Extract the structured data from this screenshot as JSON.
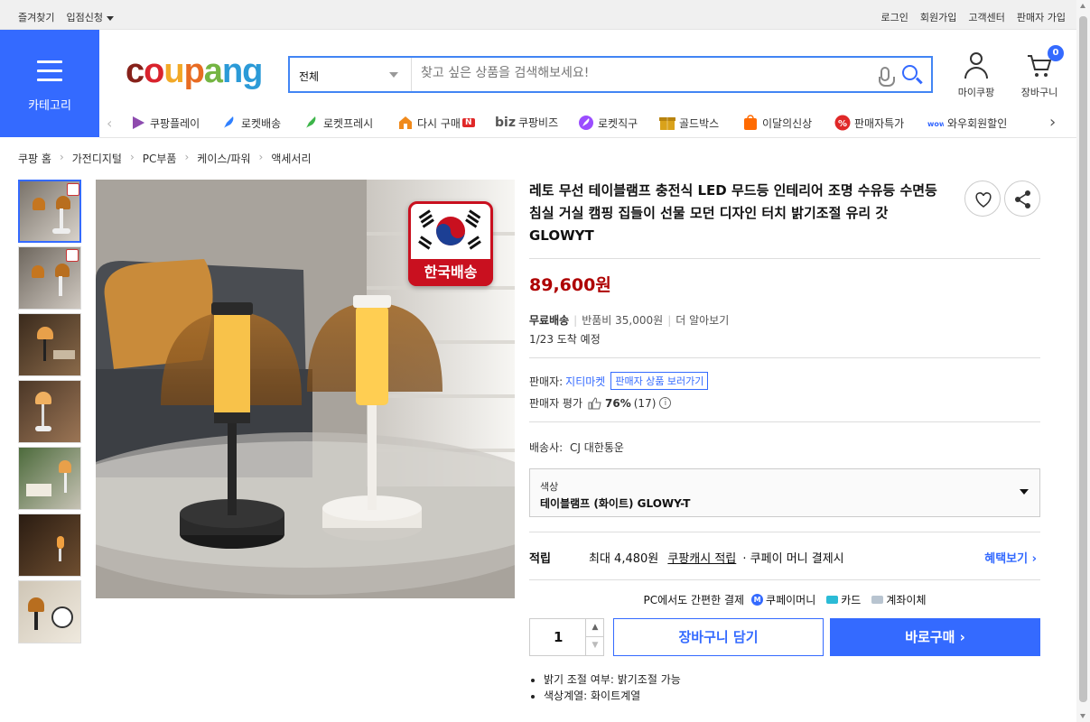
{
  "topbar": {
    "left": [
      "즐겨찾기",
      "입점신청"
    ],
    "right": [
      "로그인",
      "회원가입",
      "고객센터",
      "판매자 가입"
    ]
  },
  "category_label": "카테고리",
  "logo": {
    "c": "c",
    "o1": "o",
    "u": "u",
    "p": "p",
    "a": "a",
    "n": "n",
    "g": "g"
  },
  "search": {
    "scope": "전체",
    "placeholder": "찾고 싶은 상품을 검색해보세요!"
  },
  "header": {
    "mycoupang": "마이쿠팡",
    "cart": "장바구니",
    "cart_count": "0"
  },
  "nav": [
    {
      "label": "쿠팡플레이",
      "icon": "play-icon",
      "color": "#1f6bff"
    },
    {
      "label": "로켓배송",
      "icon": "rocket-icon",
      "color": "#2f80ff"
    },
    {
      "label": "로켓프레시",
      "icon": "rocket-fresh-icon",
      "color": "#3db54a"
    },
    {
      "label": "다시 구매",
      "icon": "rebuy-icon",
      "color": "#f08a1c",
      "badge": "N"
    },
    {
      "label": "쿠팡비즈",
      "icon": "biz-icon",
      "prefix": "biz"
    },
    {
      "label": "로켓직구",
      "icon": "global-rocket-icon",
      "color": "#9b4dff"
    },
    {
      "label": "골드박스",
      "icon": "goldbox-icon",
      "color": "#d9a21b"
    },
    {
      "label": "이달의신상",
      "icon": "new-icon",
      "color": "#ff6a00"
    },
    {
      "label": "판매자특가",
      "icon": "percent-icon",
      "color": "#e02828"
    },
    {
      "label": "와우회원할인",
      "icon": "wow-icon",
      "color": "#3366ff"
    }
  ],
  "breadcrumb": [
    "쿠팡 홈",
    "가전디지털",
    "PC부품",
    "케이스/파워",
    "액세서리"
  ],
  "product": {
    "badge_text": "한국배송",
    "title": "레토 무선 테이블램프 충전식 LED 무드등 인테리어 조명 수유등 수면등 침실 거실 캠핑 집들이 선물 모던 디자인 터치 밝기조절 유리 갓 GLOWYT",
    "price": "89,600원",
    "shipping_free": "무료배송",
    "return_fee": "반품비 35,000원",
    "learn_more": "더 알아보기",
    "arrival": "1/23 도착 예정",
    "seller_label": "판매자:",
    "seller_name": "지티마켓",
    "seller_link": "판매자 상품 보러가기",
    "rating_label": "판매자 평가",
    "rating_value": "76%",
    "rating_count": "(17)",
    "carrier_label": "배송사:",
    "carrier": "CJ 대한통운",
    "option_label": "색상",
    "option_value": "테이블램프 (화이트) GLOWY-T",
    "points_label": "적립",
    "points_text": "최대 4,480원",
    "points_link": "쿠팡캐시 적립",
    "points_suffix": "· 쿠페이 머니 결제시",
    "benefit_link": "혜택보기",
    "pc_pay": "PC에서도 간편한 결제",
    "pay_methods": [
      "쿠페이머니",
      "카드",
      "계좌이체"
    ],
    "quantity": "1",
    "add_to_cart": "장바구니 담기",
    "buy_now": "바로구매",
    "bullets": [
      "밝기 조절 여부: 밝기조절 가능",
      "색상계열: 화이트계열"
    ]
  }
}
